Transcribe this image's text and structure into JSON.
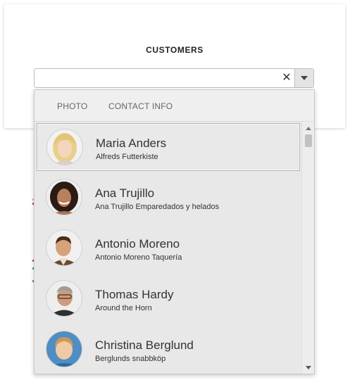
{
  "card": {
    "title": "CUSTOMERS"
  },
  "combo": {
    "value": "",
    "clear_icon": "close-icon",
    "toggle_icon": "caret-down-icon"
  },
  "popup": {
    "headers": {
      "photo": "PHOTO",
      "contact": "CONTACT INFO"
    },
    "customers": [
      {
        "name": "Maria Anders",
        "company": "Alfreds Futterkiste",
        "selected": true
      },
      {
        "name": "Ana Trujillo",
        "company": "Ana Trujillo Emparedados y helados",
        "selected": false
      },
      {
        "name": "Antonio Moreno",
        "company": "Antonio Moreno Taquería",
        "selected": false
      },
      {
        "name": "Thomas Hardy",
        "company": "Around the Horn",
        "selected": false
      },
      {
        "name": "Christina Berglund",
        "company": "Berglunds snabbköp",
        "selected": false
      }
    ]
  },
  "colors": {
    "selected_border": "#b6b6b6",
    "list_bg": "#e8e8e8"
  }
}
